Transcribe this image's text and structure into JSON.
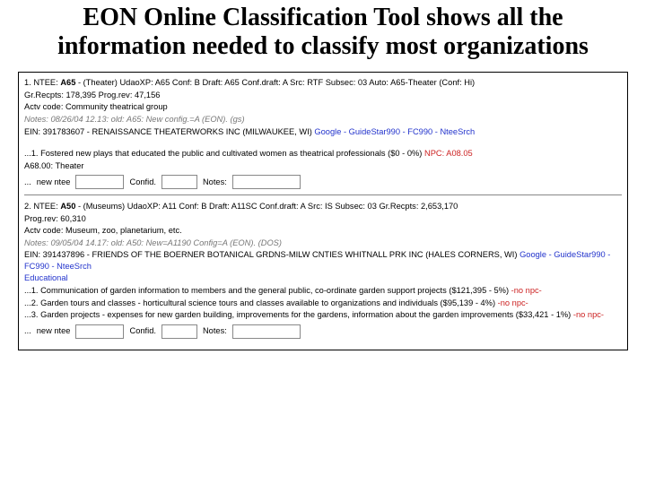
{
  "title": "EON Online Classification Tool shows all the information needed to classify most organizations",
  "labels": {
    "new_ntee": "new ntee",
    "confid": "Confid.",
    "notes": "Notes:"
  },
  "records": [
    {
      "ntee_line_prefix": "1. NTEE: ",
      "ntee_code": "A65",
      "ntee_rest": " - (Theater) UdaoXP: A65 Conf: B Draft: A65 Conf.draft: A Src: RTF Subsec: 03 Auto: A65-Theater (Conf: Hi)",
      "recpts": "Gr.Recpts: 178,395 Prog.rev: 47,156",
      "actv": "Actv code: Community theatrical group",
      "notes_line": "Notes: 08/26/04 12.13: old: A65: New config.=A (EON). (gs)",
      "ein": "EIN: 391783607 - RENAISSANCE THEATERWORKS INC (MILWAUKEE, WI) ",
      "links": "Google - GuideStar990 - FC990 - NteeSrch",
      "body": [
        {
          "text": "...1. Fostered new plays that educated the public and cultivated women as theatrical professionals ($0 - 0%) ",
          "npc": "NPC: A08.05"
        },
        {
          "text": "A68.00: Theater",
          "npc": ""
        }
      ]
    },
    {
      "ntee_line_prefix": "2. NTEE: ",
      "ntee_code": "A50",
      "ntee_rest": " - (Museums) UdaoXP: A11 Conf: B Draft: A11SC Conf.draft: A Src: IS Subsec: 03 Gr.Recpts: 2,653,170",
      "recpts": "Prog.rev: 60,310",
      "actv": "Actv code: Museum, zoo, planetarium, etc.",
      "notes_line": "Notes: 09/05/04 14.17: old: A50: New=A1190 Config=A (EON). (DOS)",
      "ein": "EIN: 391437896 - FRIENDS OF THE BOERNER BOTANICAL GRDNS-MILW CNTIES WHITNALL PRK INC (HALES CORNERS, WI) ",
      "links": "Google - GuideStar990 - FC990 - NteeSrch",
      "edu": "Educational",
      "body": [
        {
          "text": "...1. Communication of garden information to members and the general public, co-ordinate garden support projects ($121,395 - 5%) ",
          "npc": "-no npc-"
        },
        {
          "text": "...2. Garden tours and classes - horticultural science tours and classes available to organizations and individuals ($95,139 - 4%) ",
          "npc": "-no npc-"
        },
        {
          "text": "...3. Garden projects - expenses for new garden building, improvements for the gardens, information about the garden improvements ($33,421 - 1%) ",
          "npc": "-no npc-"
        }
      ]
    }
  ]
}
